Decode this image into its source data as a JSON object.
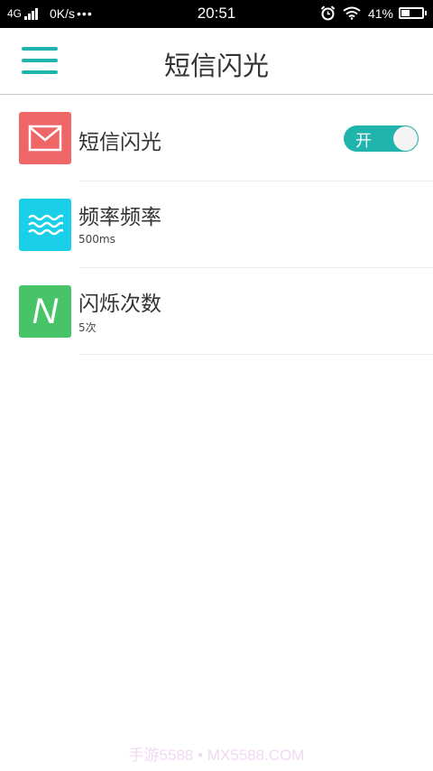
{
  "status_bar": {
    "network": "4G",
    "speed": "0K/s",
    "dots": "•••",
    "time": "20:51",
    "battery_text": "41%",
    "battery_level": 0.41,
    "icons": [
      "signal-icon",
      "alarm-icon",
      "wifi-icon",
      "battery-icon"
    ]
  },
  "header": {
    "title": "短信闪光",
    "menu_icon": "hamburger-menu-icon",
    "accent_color": "#1fb5ad"
  },
  "items": [
    {
      "title": "短信闪光",
      "icon": "envelope-icon",
      "icon_color": "#ef6666",
      "toggle": {
        "label": "开",
        "on": true
      }
    },
    {
      "title": "频率频率",
      "subtitle": "500ms",
      "icon": "wave-icon",
      "icon_color": "#1ccfe8"
    },
    {
      "title": "闪烁次数",
      "subtitle": "5次",
      "icon": "letter-n-icon",
      "icon_letter": "N",
      "icon_color": "#47c467"
    }
  ],
  "watermark": "手游5588 • MX5588.COM"
}
